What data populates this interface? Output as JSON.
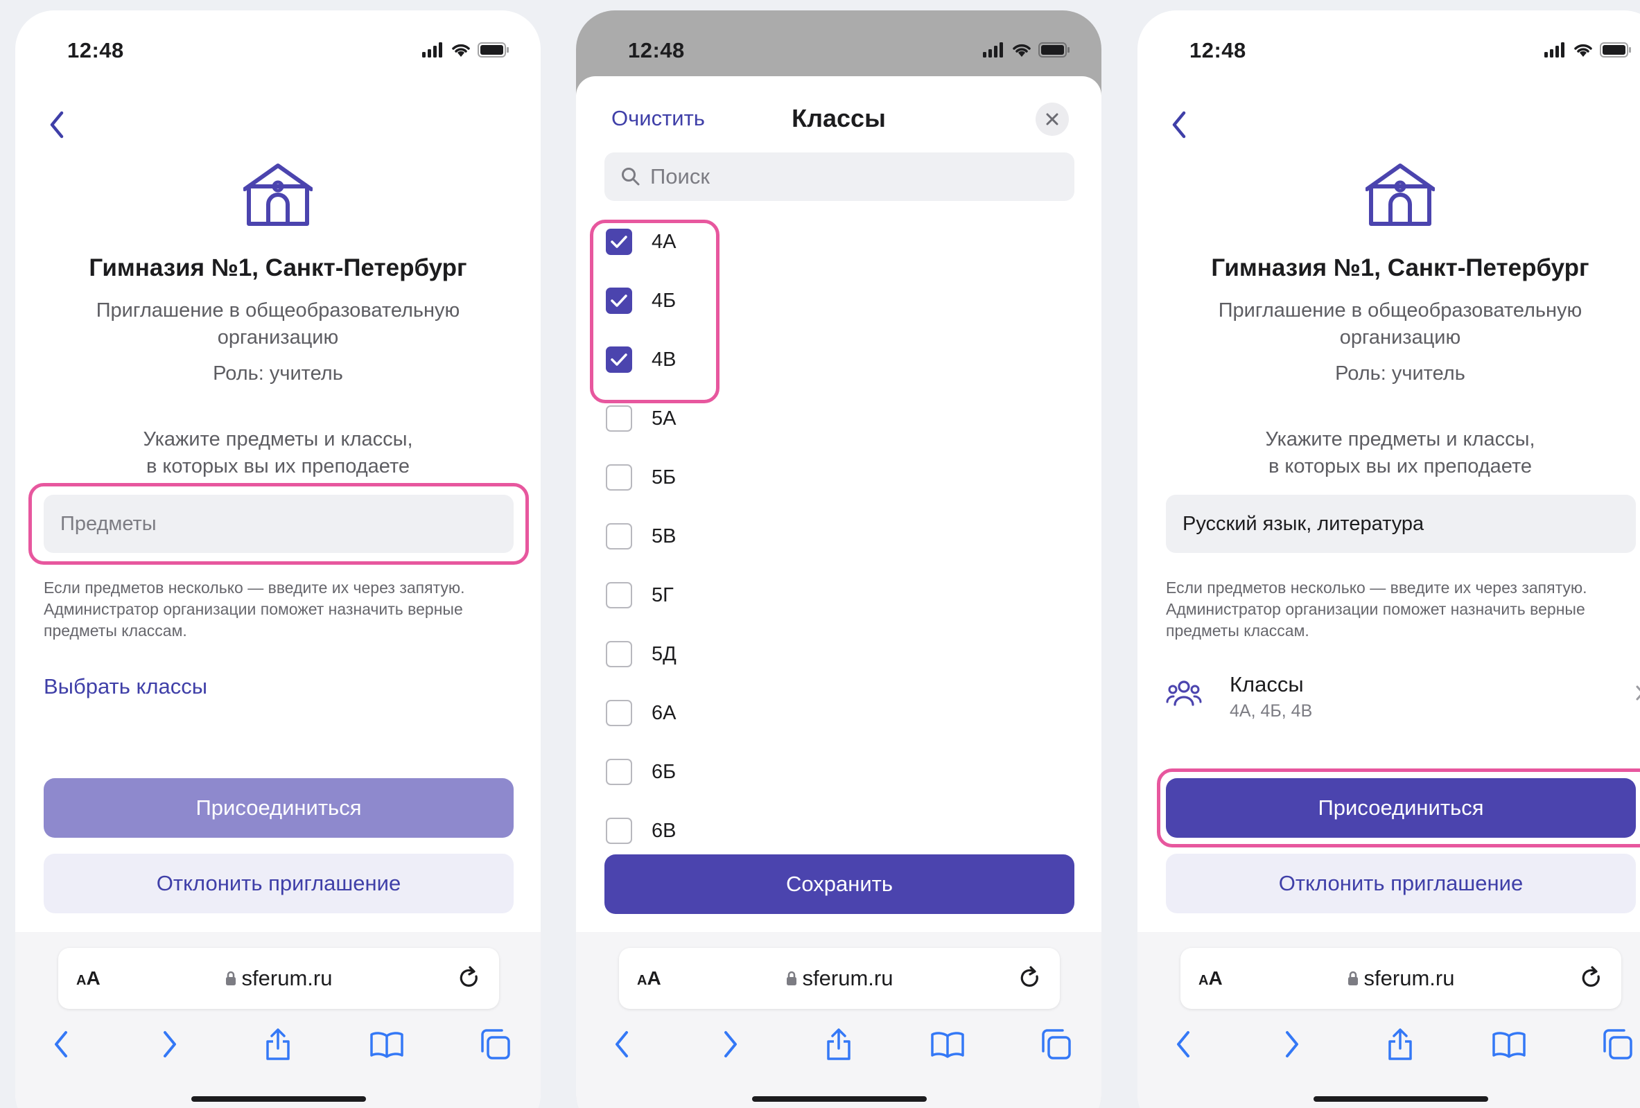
{
  "screens": {
    "invite": {
      "time": "12:48",
      "school_title": "Гимназия №1, Санкт-Петербург",
      "subtitle": "Приглашение в общеобразовательную организацию",
      "role": "Роль: учитель",
      "prompt_line1": "Укажите предметы и классы,",
      "prompt_line2": "в которых вы их преподаете",
      "subjects_placeholder": "Предметы",
      "hint": "Если предметов несколько — введите их через запятую. Администратор организации поможет назначить верные предметы классам.",
      "choose_classes_link": "Выбрать классы",
      "join_label": "Присоединиться",
      "decline_label": "Отклонить приглашение"
    },
    "class_picker": {
      "time": "12:48",
      "clear_label": "Очистить",
      "title": "Классы",
      "search_placeholder": "Поиск",
      "classes": [
        {
          "label": "4А",
          "checked": true
        },
        {
          "label": "4Б",
          "checked": true
        },
        {
          "label": "4В",
          "checked": true
        },
        {
          "label": "5А",
          "checked": false
        },
        {
          "label": "5Б",
          "checked": false
        },
        {
          "label": "5В",
          "checked": false
        },
        {
          "label": "5Г",
          "checked": false
        },
        {
          "label": "5Д",
          "checked": false
        },
        {
          "label": "6А",
          "checked": false
        },
        {
          "label": "6Б",
          "checked": false
        },
        {
          "label": "6В",
          "checked": false
        }
      ],
      "save_label": "Сохранить"
    },
    "filled": {
      "time": "12:48",
      "school_title": "Гимназия №1, Санкт-Петербург",
      "subtitle": "Приглашение в общеобразовательную организацию",
      "role": "Роль: учитель",
      "prompt_line1": "Укажите предметы и классы,",
      "prompt_line2": "в которых вы их преподаете",
      "subjects_value": "Русский язык, литература",
      "hint": "Если предметов несколько — введите их через запятую. Администратор организации поможет назначить верные предметы классам.",
      "classes_label": "Классы",
      "classes_value": "4А, 4Б, 4В",
      "join_label": "Присоединиться",
      "decline_label": "Отклонить приглашение"
    }
  },
  "browser": {
    "text_size_label": "AA",
    "url": "sferum.ru"
  },
  "colors": {
    "accent": "#4b44ae",
    "accent_disabled": "#8e89cd",
    "link": "#3f3fa8",
    "highlight": "#e7579e",
    "field_bg": "#eff0f3"
  },
  "icons": [
    "back-chevron-icon",
    "school-icon",
    "people-icon",
    "chevron-right-icon",
    "search-icon",
    "close-icon",
    "checkbox-icon",
    "lock-icon",
    "reload-icon",
    "share-icon",
    "bookmarks-icon",
    "tabs-icon"
  ]
}
